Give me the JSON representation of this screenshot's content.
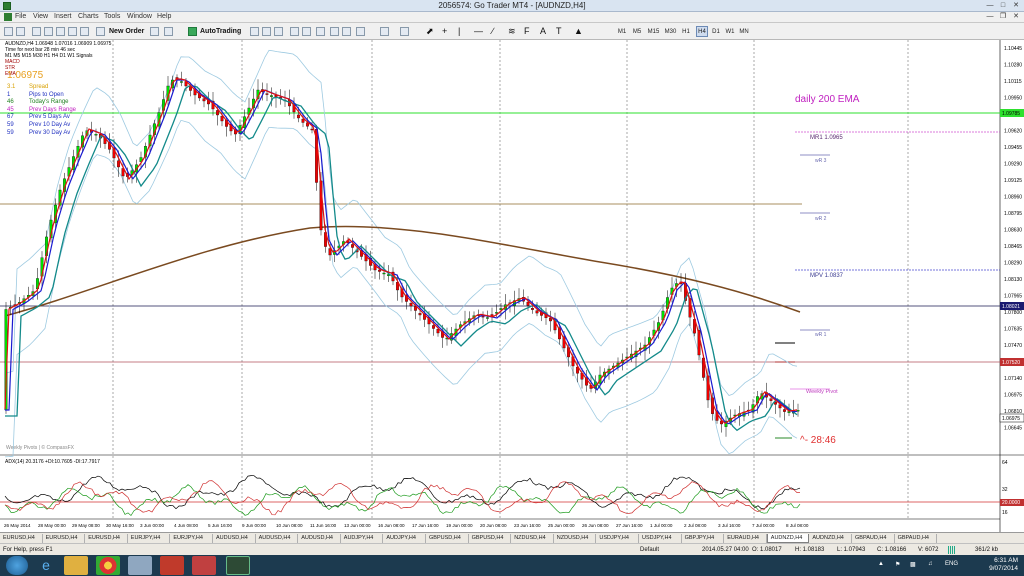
{
  "window": {
    "title": "2056574: Go Trader MT4 - [AUDNZD,H4]"
  },
  "menu": [
    "File",
    "View",
    "Insert",
    "Charts",
    "Tools",
    "Window",
    "Help"
  ],
  "toolbar": {
    "new_order": "New Order",
    "autotrading": "AutoTrading",
    "timeframes": [
      "M1",
      "M5",
      "M15",
      "M30",
      "H1",
      "H4",
      "D1",
      "W1",
      "MN"
    ],
    "active_timeframe": "H4"
  },
  "chart_info": {
    "header": "AUDNZD,H4  1.06948 1.07016 1.06909 1.06975",
    "line2": "Time for next bar 28 min 46 sec",
    "line3": "M1 M5 M15 M30 H1 H4 D1 W1 Signals",
    "line4": "MACD",
    "line5": "STR",
    "line6": "EMA"
  },
  "price_display": "1.06975",
  "stats": [
    {
      "value": "3.1",
      "label": "Spread",
      "color": "#d8a000"
    },
    {
      "value": "1",
      "label": "Pips to Open",
      "color": "#2030c0"
    },
    {
      "value": "46",
      "label": "Today's Range",
      "color": "#208020"
    },
    {
      "value": "45",
      "label": "Prev Days Range",
      "color": "#c020c0"
    },
    {
      "value": "67",
      "label": "Prev 5 Days Av",
      "color": "#2030c0"
    },
    {
      "value": "59",
      "label": "Prev 10 Day Av",
      "color": "#2030c0"
    },
    {
      "value": "59",
      "label": "Prev 30 Day Av",
      "color": "#2030c0"
    }
  ],
  "annotations": {
    "ema_note": "daily 200 EMA",
    "countdown": "^- 28:46",
    "watermark": "Weekly Pivots | © CompassFX",
    "mr1": "MR1  1.0965",
    "wr3": "wR 3",
    "wr2": "wR 2",
    "mpv": "MPV  1.0837",
    "wr1": "wR 1",
    "weekly_pivot": "Weekly Pivot"
  },
  "price_axis": [
    "1.10445",
    "1.10280",
    "1.10115",
    "1.09950",
    "1.09785",
    "1.09620",
    "1.09455",
    "1.09290",
    "1.09125",
    "1.08960",
    "1.08795",
    "1.08630",
    "1.08465",
    "1.08290",
    "1.08130",
    "1.07965",
    "1.07800",
    "1.07635",
    "1.07470",
    "1.07305",
    "1.07140",
    "1.06975",
    "1.06810",
    "1.06645"
  ],
  "price_labels": {
    "green": "1.09785",
    "navy": "1.08021",
    "red": "1.07520",
    "current": "1.06975"
  },
  "indicator": {
    "label": "ADX(14) 20.3176 +DI:10.7605 -DI:17.7917",
    "levels": [
      "64",
      "32",
      "20.0000",
      "16"
    ]
  },
  "time_axis": [
    "26 May 2014",
    "28 May 00:00",
    "29 May 08:00",
    "30 May 16:00",
    "3 Jun 00:00",
    "4 Jun 08:00",
    "5 Jun 16:00",
    "9 Jun 00:00",
    "10 Jun 08:00",
    "11 Jun 16:00",
    "13 Jun 00:00",
    "16 Jun 08:00",
    "17 Jun 16:00",
    "19 Jun 00:00",
    "20 Jun 08:00",
    "23 Jun 16:00",
    "25 Jun 00:00",
    "26 Jun 08:00",
    "27 Jun 16:00",
    "1 Jul 00:00",
    "2 Jul 08:00",
    "3 Jul 16:00",
    "7 Jul 00:00",
    "8 Jul 08:00"
  ],
  "tabs": [
    "EURUSD,H4",
    "EURUSD,H4",
    "EURUSD,H4",
    "EURJPY,H4",
    "EURJPY,H4",
    "AUDUSD,H4",
    "AUDUSD,H4",
    "AUDUSD,H4",
    "AUDJPY,H4",
    "AUDJPY,H4",
    "GBPUSD,H4",
    "GBPUSD,H4",
    "NZDUSD,H4",
    "NZDUSD,H4",
    "USDJPY,H4",
    "USDJPY,H4",
    "GBPJPY,H4",
    "EURAUD,H4",
    "AUDNZD,H4",
    "AUDNZD,H4",
    "GBPAUD,H4",
    "GBPAUD,H4"
  ],
  "active_tab_index": 18,
  "status": {
    "help": "For Help, press F1",
    "profile": "Default",
    "datetime": "2014.05.27 04:00",
    "open": "O: 1.08017",
    "high": "H: 1.08183",
    "low": "L: 1.07943",
    "close": "C: 1.08166",
    "volume": "V: 6072",
    "traffic": "361/2 kb"
  },
  "taskbar": {
    "lang": "ENG",
    "time": "6:31 AM",
    "date": "9/07/2014"
  }
}
